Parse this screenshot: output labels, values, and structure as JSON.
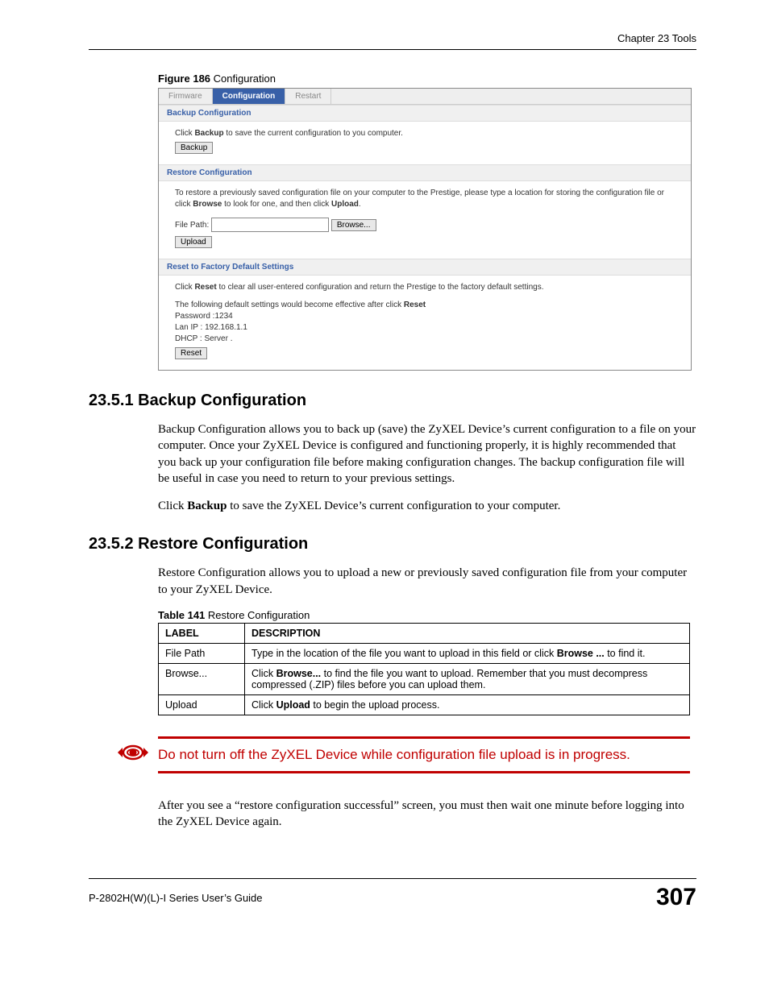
{
  "header": {
    "chapter": "Chapter 23 Tools"
  },
  "figure": {
    "caption_bold": "Figure 186",
    "caption_rest": "   Configuration",
    "tabs": {
      "firmware": "Firmware",
      "configuration": "Configuration",
      "restart": "Restart"
    },
    "backup": {
      "title": "Backup Configuration",
      "text_pre": "Click ",
      "text_bold": "Backup",
      "text_post": " to save the current configuration to you computer.",
      "btn": "Backup"
    },
    "restore": {
      "title": "Restore Configuration",
      "text_pre": "To restore a previously saved configuration file on your computer to the Prestige, please type a location for storing the configuration file or click ",
      "text_bold1": "Browse",
      "text_mid": " to look for one, and then click ",
      "text_bold2": "Upload",
      "text_end": ".",
      "file_label": "File Path:",
      "browse_btn": "Browse...",
      "upload_btn": "Upload"
    },
    "reset": {
      "title": "Reset to Factory Default Settings",
      "line1_pre": "Click ",
      "line1_bold": "Reset",
      "line1_post": " to clear all user-entered configuration and return the Prestige to the factory default settings.",
      "line2_pre": "The following default settings would become effective after click ",
      "line2_bold": "Reset",
      "d1": "Password :1234",
      "d2": "Lan IP : 192.168.1.1",
      "d3": "DHCP : Server .",
      "btn": "Reset"
    }
  },
  "sec1": {
    "heading": "23.5.1  Backup Configuration",
    "para1": "Backup Configuration allows you to back up (save) the ZyXEL Device’s current configuration to a file on your computer. Once your ZyXEL Device is configured and functioning properly, it is highly recommended that you back up your configuration file before making configuration changes. The backup configuration file will be useful in case you need to return to your previous settings.",
    "para2_pre": "Click ",
    "para2_bold": "Backup",
    "para2_post": " to save the ZyXEL Device’s current configuration to your computer."
  },
  "sec2": {
    "heading": "23.5.2  Restore Configuration",
    "para1": "Restore Configuration allows you to upload a new or previously saved configuration file from your computer to your ZyXEL Device."
  },
  "table": {
    "caption_bold": "Table 141",
    "caption_rest": "   Restore Configuration",
    "h1": "LABEL",
    "h2": "DESCRIPTION",
    "r1c1": "File Path",
    "r1c2_pre": "Type in the location of the file you want to upload in this field or click ",
    "r1c2_bold": "Browse ...",
    "r1c2_post": " to find it.",
    "r2c1": "Browse...",
    "r2c2_pre": "Click ",
    "r2c2_bold": "Browse...",
    "r2c2_post": " to find the file you want to upload. Remember that you must decompress compressed (.ZIP) files before you can upload them.",
    "r3c1": "Upload",
    "r3c2_pre": "Click ",
    "r3c2_bold": "Upload",
    "r3c2_post": " to begin the upload process."
  },
  "warning": "Do not turn off the ZyXEL Device while configuration file upload is in progress.",
  "closing": "After you see a “restore configuration successful” screen, you must then wait one minute before logging into the ZyXEL Device again.",
  "footer": {
    "left": "P-2802H(W)(L)-I Series User’s Guide",
    "page": "307"
  }
}
